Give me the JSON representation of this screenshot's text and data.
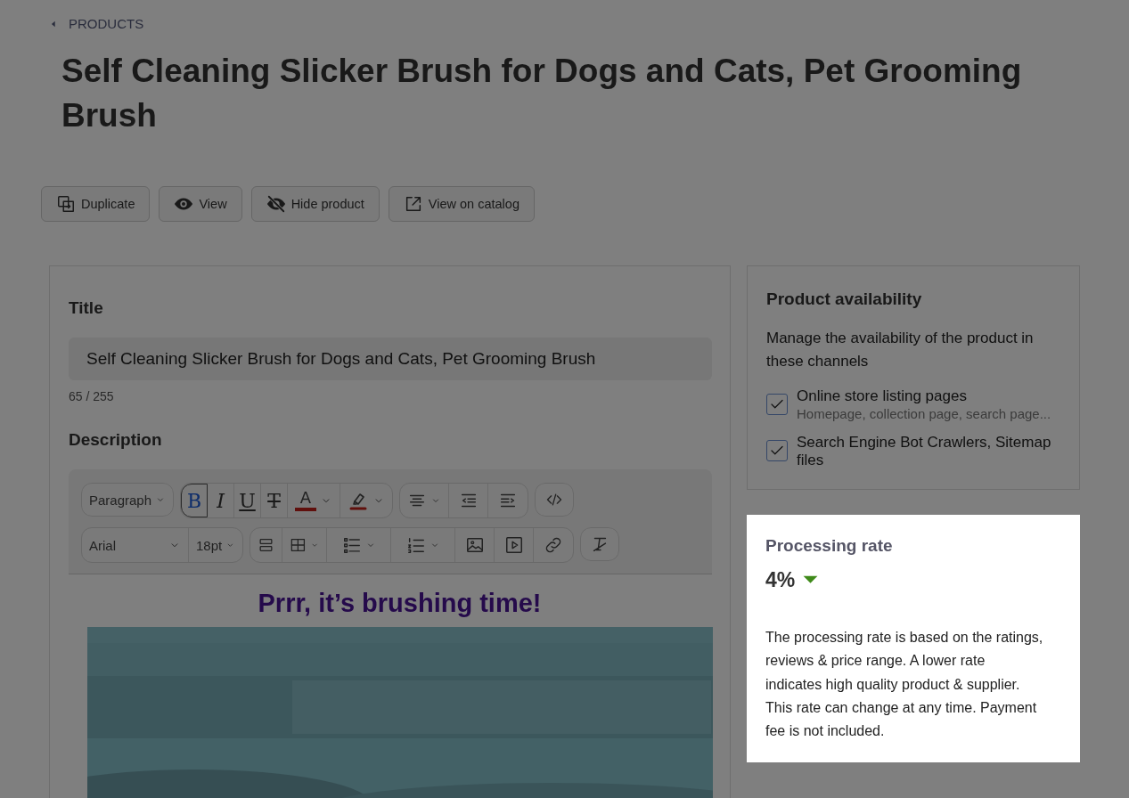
{
  "breadcrumb": {
    "label": "PRODUCTS"
  },
  "page_title": "Self Cleaning Slicker Brush for Dogs and Cats, Pet Grooming Brush",
  "actions": [
    {
      "label": "Duplicate"
    },
    {
      "label": "View"
    },
    {
      "label": "Hide product"
    },
    {
      "label": "View on catalog"
    }
  ],
  "details": {
    "title_label": "Title",
    "title_value": "Self Cleaning Slicker Brush for Dogs and Cats, Pet Grooming Brush",
    "char_count": "65 / 255",
    "description_label": "Description",
    "toolbar": {
      "block_format": "Paragraph",
      "format_buttons": [
        {
          "label": "B",
          "selected": true
        },
        {
          "label": "I",
          "selected": false
        },
        {
          "label": "U",
          "selected": false
        },
        {
          "label": "T",
          "selected": false
        }
      ],
      "text_color_label": "A",
      "font": "Arial",
      "font_size": "18pt"
    },
    "content": {
      "heading": "Prrr, it’s brushing time!"
    }
  },
  "availability": {
    "title": "Product availability",
    "description": "Manage the availability of the product in these channels",
    "channels": [
      {
        "label": "Online store listing pages",
        "hint": "Homepage, collection page, search page...",
        "checked": true
      },
      {
        "label": "Search Engine Bot Crawlers, Sitemap files",
        "checked": true
      }
    ]
  },
  "processing_rate": {
    "highlighted": true,
    "title": "Processing rate",
    "value": "4%",
    "description": "The processing rate is based on the ratings, reviews & price range. A lower rate indicates high quality product & supplier. This rate can change at any time. Payment fee is not included."
  }
}
